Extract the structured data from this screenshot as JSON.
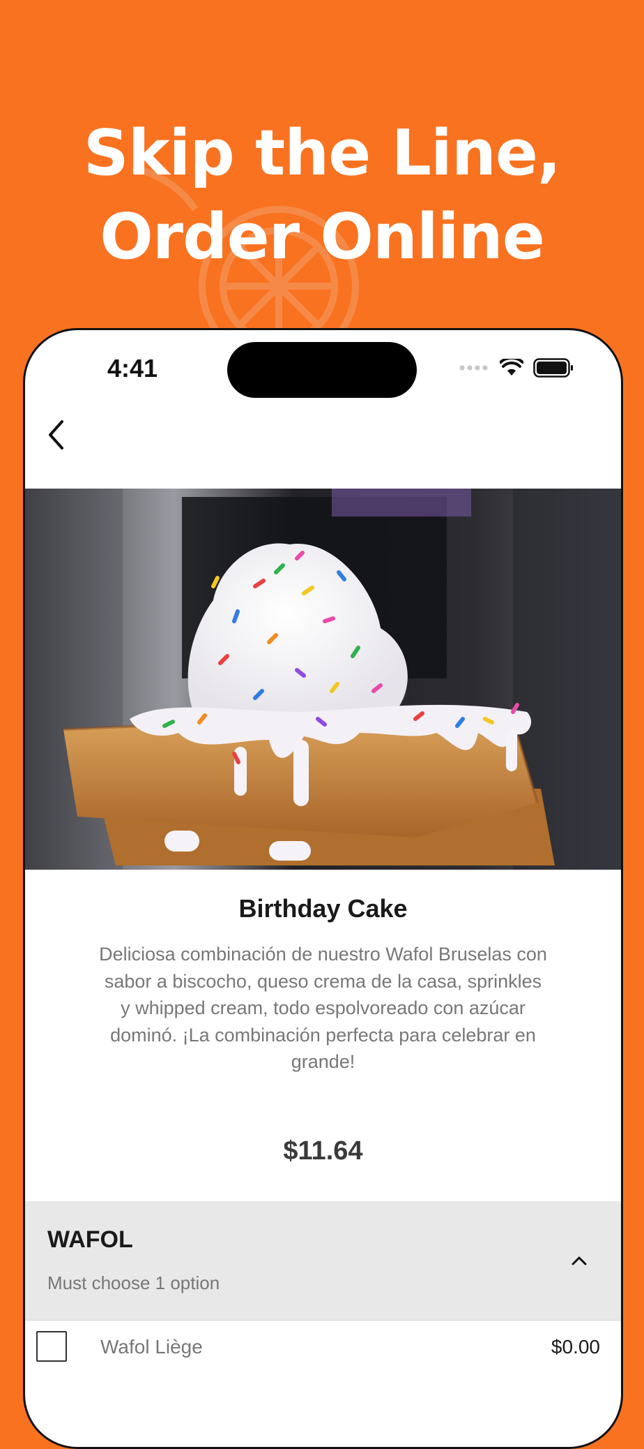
{
  "promo": {
    "headline_line1": "Skip the Line,",
    "headline_line2": "Order Online",
    "background_color": "#F97220"
  },
  "status_bar": {
    "time": "4:41",
    "icons": [
      "signal-icon",
      "wifi-icon",
      "battery-icon"
    ]
  },
  "nav": {
    "back_icon": "chevron-left-icon"
  },
  "product": {
    "image_alt": "waffle-with-whipped-cream-and-sprinkles",
    "name": "Birthday Cake",
    "description": "Deliciosa combinación de nuestro Wafol Bruselas con sabor a biscocho, queso crema de la casa, sprinkles y whipped cream, todo espolvoreado con azúcar dominó. ¡La combinación perfecta para celebrar en grande!",
    "price": "$11.64"
  },
  "option_group": {
    "title": "WAFOL",
    "subtitle": "Must choose 1 option",
    "toggle_icon": "chevron-up-icon",
    "options": [
      {
        "name": "Wafol Liège",
        "price": "$0.00",
        "checked": false
      }
    ]
  }
}
